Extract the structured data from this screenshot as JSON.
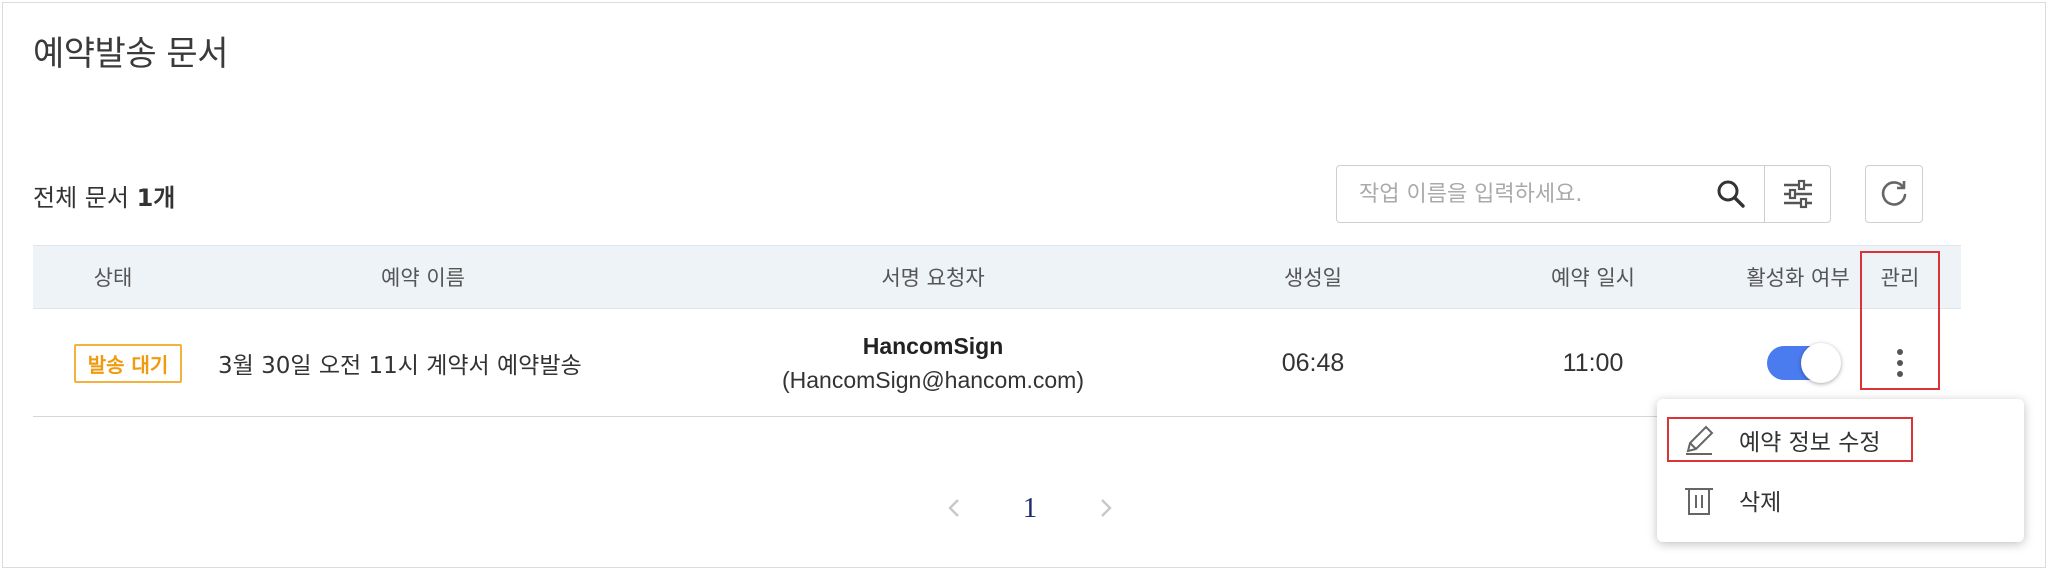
{
  "page": {
    "title": "예약발송 문서"
  },
  "summary": {
    "prefix": "전체 문서",
    "count": "1개"
  },
  "search": {
    "placeholder": "작업 이름을 입력하세요."
  },
  "icons": {
    "search": "search-icon",
    "filter": "sliders-icon",
    "refresh": "refresh-icon",
    "more": "kebab-icon",
    "edit": "pencil-icon",
    "delete": "trash-icon",
    "prev": "chevron-left-icon",
    "next": "chevron-right-icon"
  },
  "table": {
    "headers": {
      "status": "상태",
      "name": "예약 이름",
      "requester": "서명 요청자",
      "created": "생성일",
      "scheduled": "예약 일시",
      "active": "활성화 여부",
      "manage": "관리"
    },
    "rows": [
      {
        "status": "발송 대기",
        "name": "3월 30일 오전 11시 계약서 예약발송",
        "requester_name": "HancomSign",
        "requester_email": "(HancomSign@hancom.com)",
        "created": "06:48",
        "scheduled": "11:00",
        "active": true
      }
    ]
  },
  "pagination": {
    "current": "1"
  },
  "menu": {
    "edit": "예약 정보 수정",
    "delete": "삭제"
  },
  "colors": {
    "accent": "#4a7cf0",
    "badge": "#f4b13e",
    "highlight": "#d9343a",
    "header_bg": "#eef3f8"
  }
}
